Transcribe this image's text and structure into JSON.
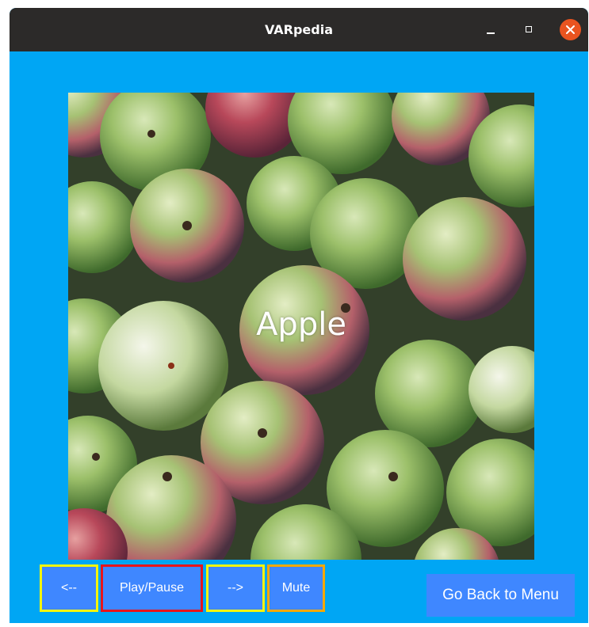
{
  "window": {
    "title": "VARpedia"
  },
  "media": {
    "caption": "Apple",
    "image_subject": "apples-photo"
  },
  "controls": {
    "prev_label": "<--",
    "play_pause_label": "Play/Pause",
    "next_label": "-->",
    "mute_label": "Mute",
    "menu_label": "Go Back to Menu"
  },
  "colors": {
    "background": "#00a6f4",
    "button": "#3f87ff",
    "titlebar": "#2c2a29",
    "close_button": "#e95420",
    "highlight_yellow": "#f5f50a",
    "highlight_red": "#e8141c",
    "highlight_orange": "#f5a800"
  }
}
